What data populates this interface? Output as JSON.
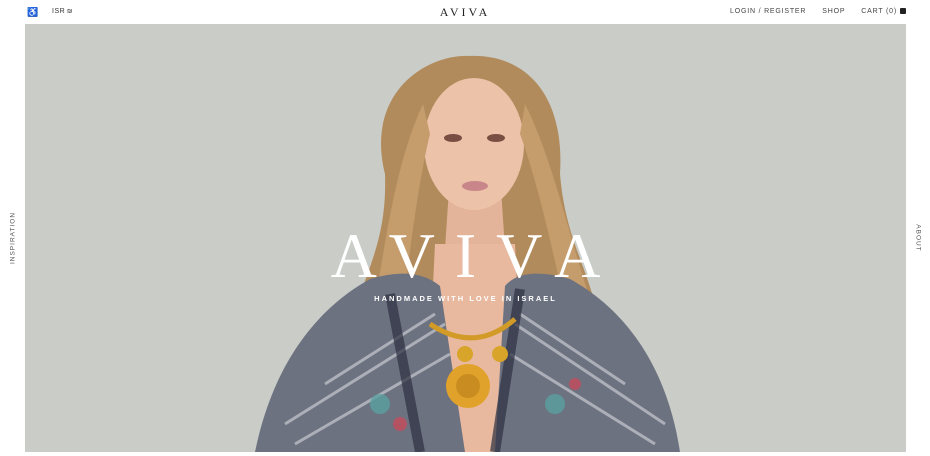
{
  "topbar": {
    "accessibility_icon": "accessibility-icon",
    "currency_label": "ISR",
    "currency_icon": "currency-icon",
    "logo": "AVIVA",
    "nav": {
      "login_label": "LOGIN / REGISTER",
      "shop_label": "SHOP",
      "cart_label": "CART (0)",
      "cart_icon": "shopping-bag-icon"
    }
  },
  "side": {
    "left_label": "INSPIRATION",
    "right_label": "ABOUT"
  },
  "hero": {
    "title": "AVIVA",
    "tagline": "HANDMADE WITH LOVE IN ISRAEL",
    "background_color": "#c9ccc7"
  }
}
